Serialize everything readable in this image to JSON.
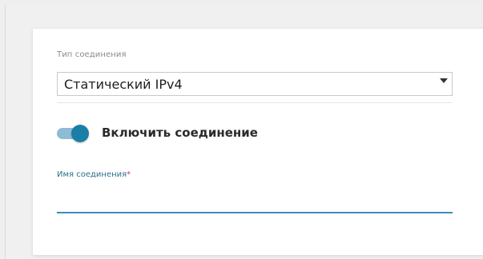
{
  "connection": {
    "type_label": "Тип соединения",
    "type_value": "Статический IPv4",
    "enable_label": "Включить соединение",
    "enable_state": true,
    "name_label": "Имя соединения",
    "required_mark": "*",
    "name_value": ""
  },
  "colors": {
    "accent": "#1b7ea7",
    "toggle_track": "#8dbcd6",
    "required": "#d0443a",
    "input_underline": "#3a8eb5"
  },
  "icons": {
    "select_arrow": "chevron-down-icon"
  }
}
